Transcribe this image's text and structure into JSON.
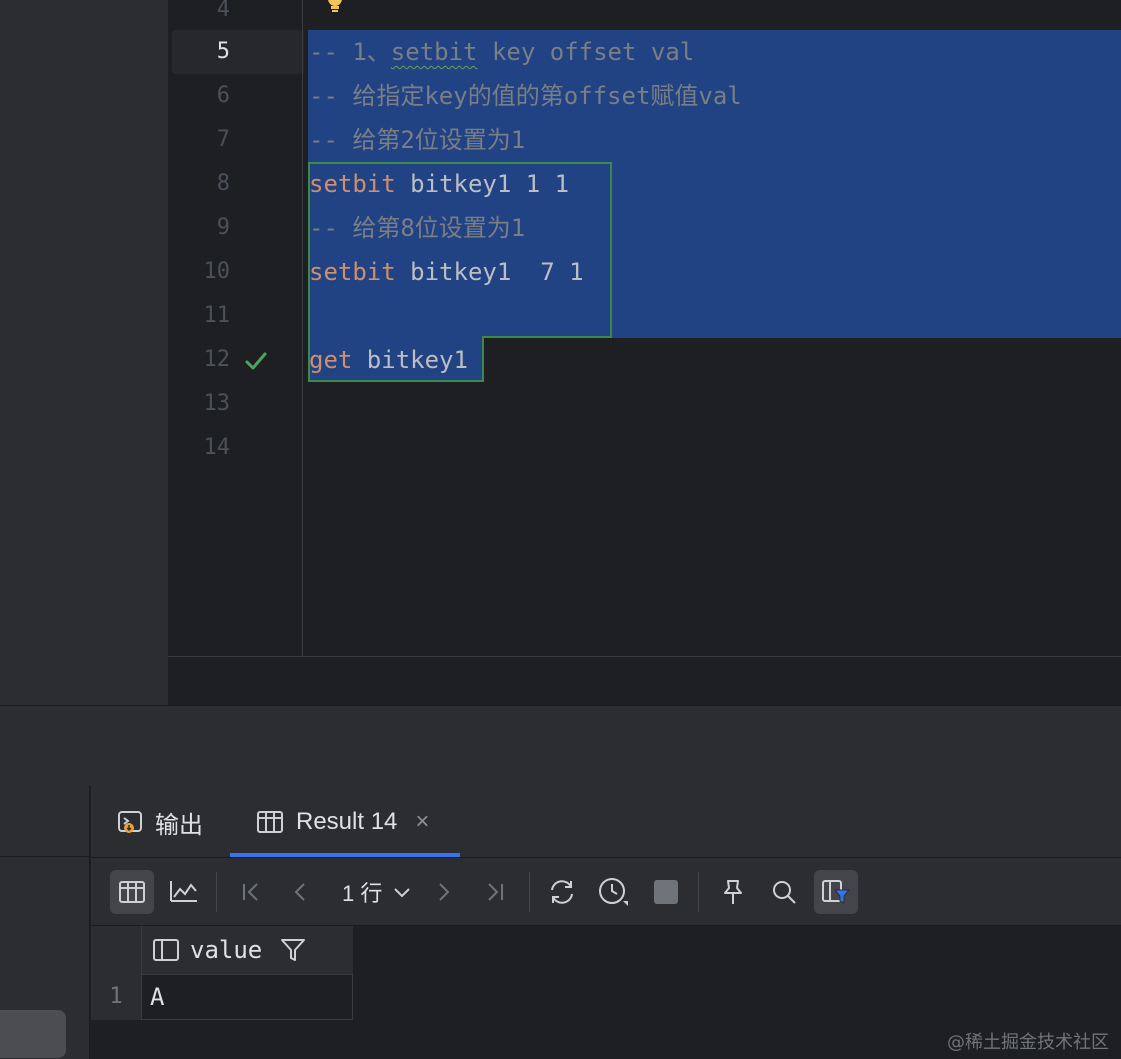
{
  "editor": {
    "lines": [
      {
        "num": "4",
        "text": ""
      },
      {
        "num": "5",
        "text": "-- 1、setbit key offset val"
      },
      {
        "num": "6",
        "text": "-- 给指定key的值的第offset赋值val"
      },
      {
        "num": "7",
        "text": "-- 给第2位设置为1"
      },
      {
        "num": "8",
        "kw": "setbit",
        "rest": " bitkey1 1 1"
      },
      {
        "num": "9",
        "text": "-- 给第8位设置为1"
      },
      {
        "num": "10",
        "kw": "setbit",
        "rest": " bitkey1  7 1"
      },
      {
        "num": "11",
        "text": ""
      },
      {
        "num": "12",
        "kw": "get",
        "rest": " bitkey1"
      },
      {
        "num": "13",
        "text": ""
      },
      {
        "num": "14",
        "text": ""
      }
    ],
    "line5_prefix": "-- 1、",
    "line5_wavy": "setbit",
    "line5_suffix": " key offset val",
    "current_line": "5"
  },
  "panel": {
    "tabs": [
      {
        "label": "输出",
        "icon": "output-console-icon"
      },
      {
        "label": "Result 14",
        "icon": "table-grid-icon",
        "active": true
      }
    ],
    "close_symbol": "×",
    "rows_label": "1 行",
    "columns": [
      "value"
    ],
    "rows": [
      {
        "num": "1",
        "value": "A"
      }
    ]
  },
  "watermark": "@稀土掘金技术社区",
  "colors": {
    "selection": "#214283",
    "keyword": "#cf8e6d",
    "comment": "#7a7e85",
    "success": "#4ea35a",
    "accent": "#3574f0"
  }
}
